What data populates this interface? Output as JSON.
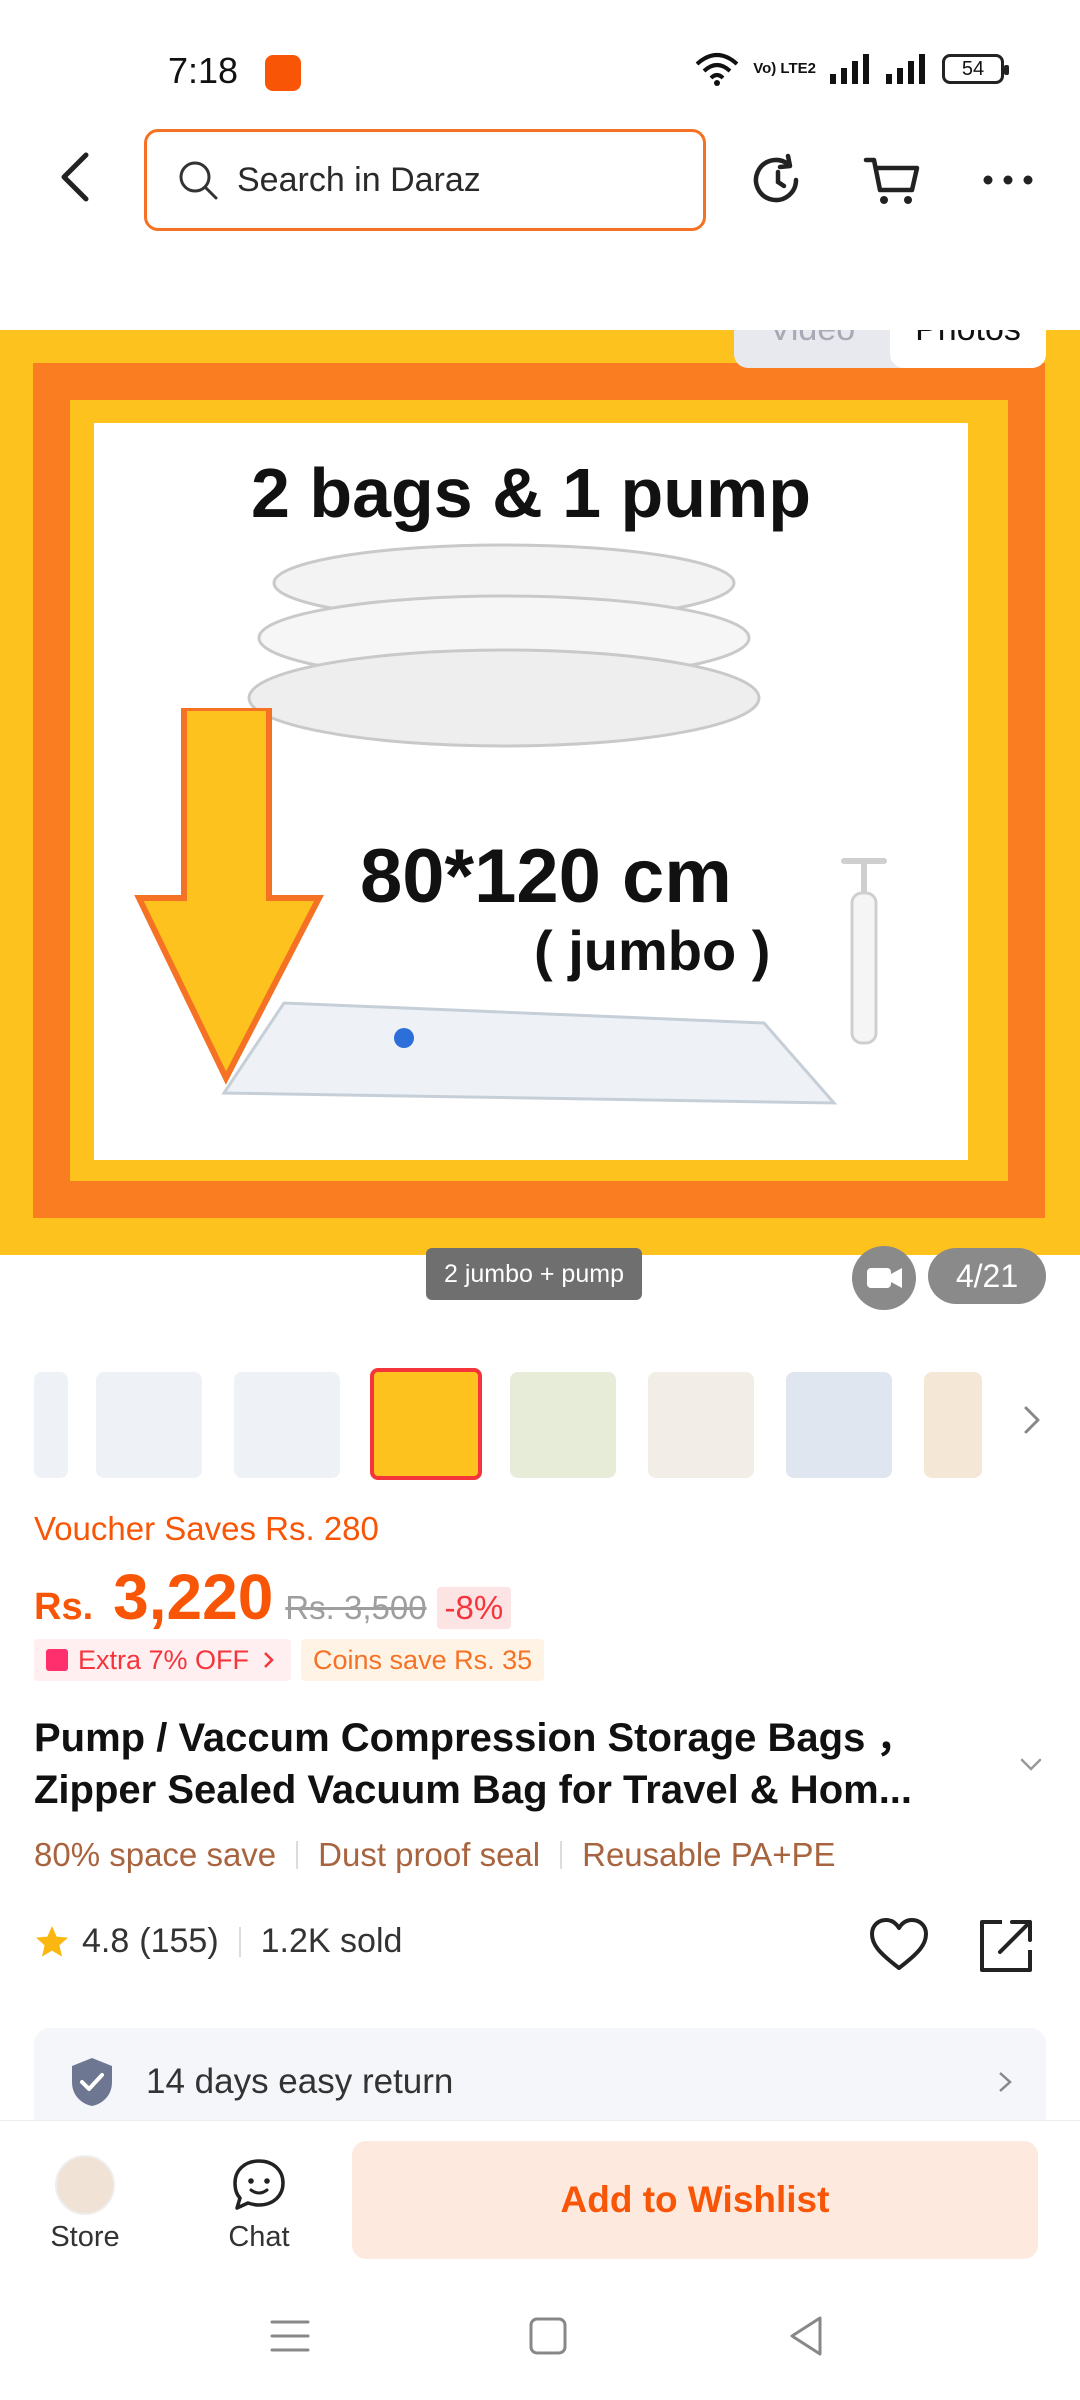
{
  "status_bar": {
    "time": "7:18",
    "network": "Vo) LTE2",
    "battery": "54"
  },
  "search": {
    "placeholder": "Search in Daraz"
  },
  "gallery": {
    "toggle": {
      "video": "Video",
      "photos": "Photos"
    },
    "image_text": {
      "headline": "2 bags & 1 pump",
      "size": "80*120 cm",
      "size_note": "( jumbo )"
    },
    "variant_tag": "2 jumbo + pump",
    "counter": "4/21"
  },
  "price": {
    "voucher": "Voucher Saves Rs. 280",
    "currency": "Rs.",
    "current": "3,220",
    "original": "Rs. 3,500",
    "discount": "-8%",
    "promo_extra": "Extra 7% OFF",
    "promo_coins": "Coins save Rs. 35"
  },
  "product": {
    "title": "Pump / Vaccum Compression Storage Bags ，Zipper Sealed Vacuum Bag for Travel & Hom...",
    "features": [
      "80% space save",
      "Dust proof seal",
      "Reusable PA+PE"
    ],
    "rating": "4.8",
    "reviews": "(155)",
    "sold": "1.2K sold"
  },
  "service": {
    "return": "14 days easy return"
  },
  "bottom_bar": {
    "store": "Store",
    "chat": "Chat",
    "wishlist": "Add to Wishlist"
  },
  "colors": {
    "accent": "#f85606",
    "gallery_yellow": "#fdc21d",
    "gallery_orange": "#fb7d22"
  }
}
